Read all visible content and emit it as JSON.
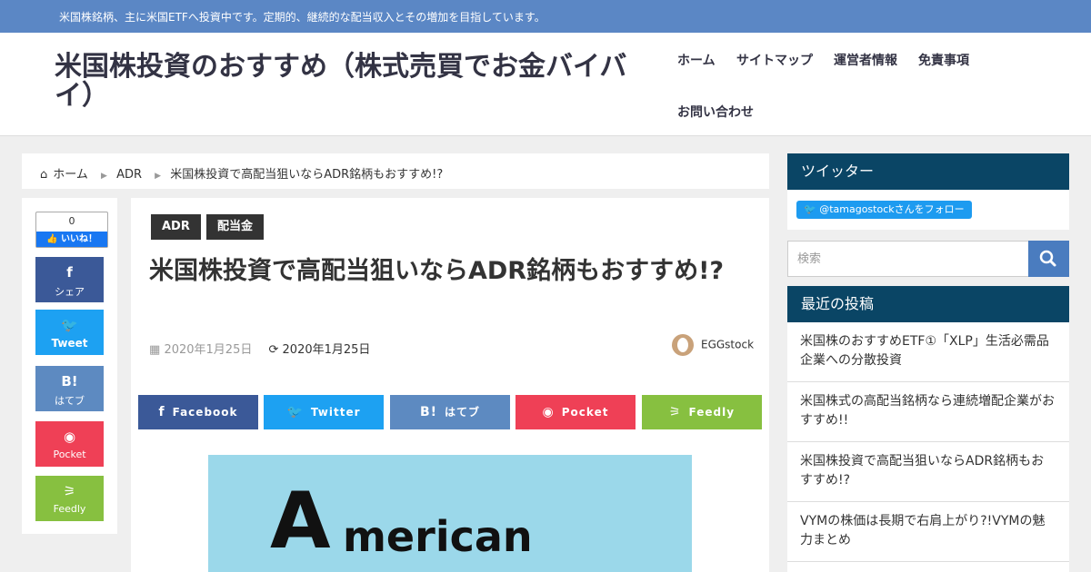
{
  "topbar": {
    "tagline": "米国株銘柄、主に米国ETFへ投資中です。定期的、継続的な配当収入とその増加を目指しています。"
  },
  "header": {
    "site_title": "米国株投資のおすすめ（株式売買でお金バイバイ）",
    "nav": [
      "ホーム",
      "サイトマップ",
      "運営者情報",
      "免責事項",
      "お問い合わせ"
    ]
  },
  "breadcrumb": {
    "home": "ホーム",
    "category": "ADR",
    "current": "米国株投資で高配当狙いならADR銘柄もおすすめ!?"
  },
  "share_column": {
    "like_count": "0",
    "like_label": "いいね！",
    "buttons": [
      {
        "icon": "f",
        "label": "シェア",
        "color": "#3b5998"
      },
      {
        "icon": "🐦",
        "label": "Tweet",
        "color": "#1da1f2"
      },
      {
        "icon": "B!",
        "label": "はてブ",
        "color": "#5d8ac1"
      },
      {
        "icon": "◉",
        "label": "Pocket",
        "color": "#ef4056"
      },
      {
        "icon": "⚞",
        "label": "Feedly",
        "color": "#87c040"
      }
    ]
  },
  "article": {
    "tags": [
      "ADR",
      "配当金"
    ],
    "title": "米国株投資で高配当狙いならADR銘柄もおすすめ!?",
    "published": "2020年1月25日",
    "updated": "2020年1月25日",
    "author": "EGGstock",
    "share_buttons": [
      {
        "icon": "f",
        "label": "Facebook",
        "color": "#3b5998"
      },
      {
        "icon": "🐦",
        "label": "Twitter",
        "color": "#1da1f2"
      },
      {
        "icon": "B!",
        "label": "はてブ",
        "color": "#5d8ac1"
      },
      {
        "icon": "◉",
        "label": "Pocket",
        "color": "#ef4056"
      },
      {
        "icon": "⚞",
        "label": "Feedly",
        "color": "#87c040"
      }
    ],
    "eyecatch": {
      "first_letter": "A",
      "rest": "merican"
    }
  },
  "sidebar": {
    "twitter_heading": "ツイッター",
    "twitter_follow": "@tamagostockさんをフォロー",
    "search_placeholder": "検索",
    "recent_heading": "最近の投稿",
    "recent_posts": [
      "米国株のおすすめETF①「XLP」生活必需品企業への分散投資",
      "米国株式の高配当銘柄なら連続増配企業がおすすめ!!",
      "米国株投資で高配当狙いならADR銘柄もおすすめ!?",
      "VYMの株価は長期で右肩上がり?!VYMの魅力まとめ"
    ]
  }
}
